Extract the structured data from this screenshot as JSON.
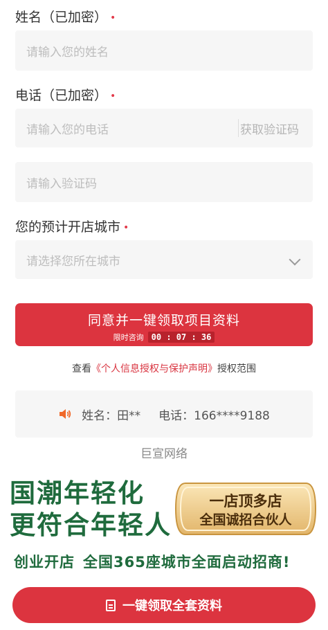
{
  "form": {
    "name_label": "姓名（已加密）",
    "name_placeholder": "请输入您的姓名",
    "phone_label": "电话（已加密）",
    "phone_placeholder": "请输入您的电话",
    "get_code": "获取验证码",
    "code_placeholder": "请输入验证码",
    "city_label": "您的预计开店城市",
    "city_placeholder": "请选择您所在城市",
    "required_mark": "•"
  },
  "cta": {
    "main": "同意并一键领取项目资料",
    "limit_label": "限时咨询",
    "timer": "00 : 07 : 36"
  },
  "privacy": {
    "prefix": "查看",
    "link": "《个人信息授权与保护声明》",
    "suffix": "授权范围"
  },
  "info": {
    "name": "姓名：田**",
    "phone": "电话：166****9188"
  },
  "company": "巨宣网络",
  "banner": {
    "line1": "国潮年轻化",
    "line2": "更符合年轻人",
    "badge_line1": "一店顶多店",
    "badge_line2": "全国诚招合伙人",
    "slogan_a": "创业开店",
    "slogan_b": "全国365座城市全面启动招商!"
  },
  "bottom_button": "一键领取全套资料",
  "colors": {
    "accent": "#dc343f",
    "green": "#1f6b3d",
    "gold": "#e8c489"
  }
}
